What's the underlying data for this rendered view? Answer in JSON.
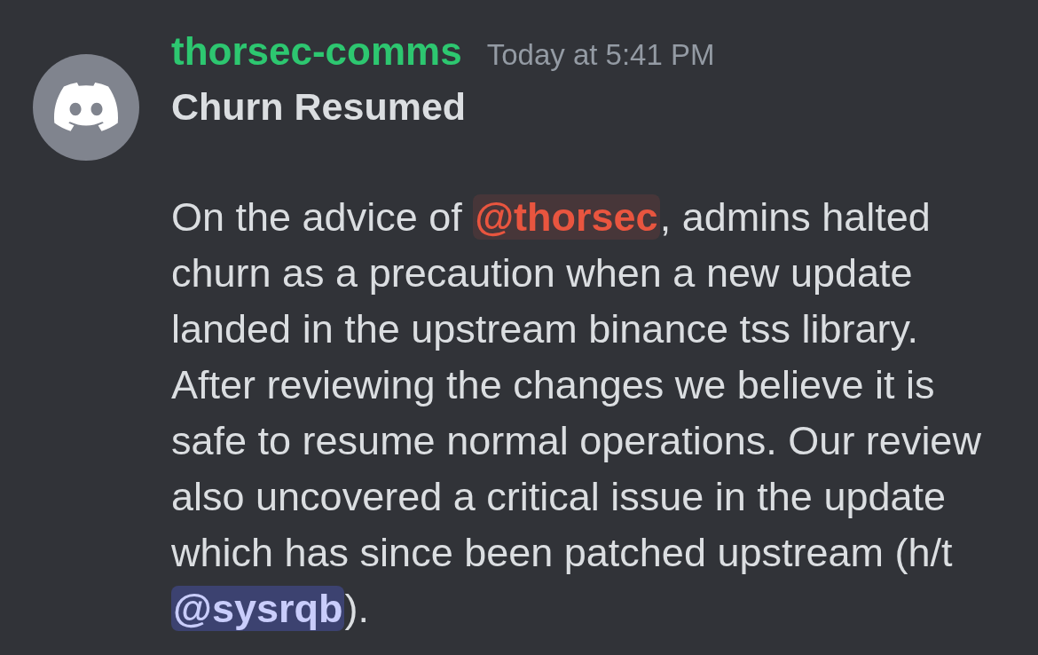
{
  "message": {
    "author": "thorsec-comms",
    "timestamp": "Today at 5:41 PM",
    "title": "Churn Resumed",
    "body": [
      {
        "kind": "text",
        "text": "On the advice of "
      },
      {
        "kind": "role-mention",
        "text": "@thorsec",
        "color": "#e9553f"
      },
      {
        "kind": "text",
        "text": ", admins halted churn as a precaution when a new update landed in the upstream binance tss library. After reviewing the changes we believe it is safe to resume normal operations. Our review also uncovered a critical issue in the update which has since been patched upstream (h/t "
      },
      {
        "kind": "user-mention",
        "text": "@sysrqb"
      },
      {
        "kind": "text",
        "text": ")."
      }
    ]
  }
}
